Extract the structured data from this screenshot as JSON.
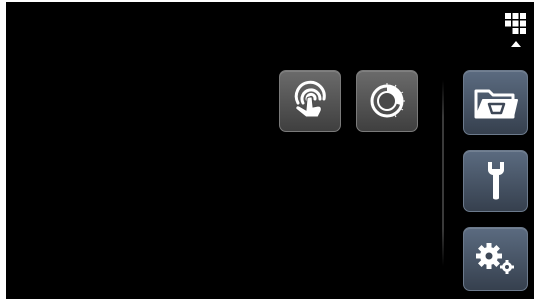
{
  "screen": {
    "background": "#000000"
  },
  "top_right": {
    "grid_icon": "grid-menu-icon",
    "caret_icon": "caret-up-icon"
  },
  "actions": [
    {
      "id": "touch",
      "icon": "touch-hand-icon",
      "style": "gray"
    },
    {
      "id": "timer",
      "icon": "timer-dial-icon",
      "style": "gray"
    }
  ],
  "sidebar": [
    {
      "id": "program",
      "icon": "folder-basket-icon",
      "style": "blue"
    },
    {
      "id": "service",
      "icon": "wrench-icon",
      "style": "blue"
    },
    {
      "id": "settings",
      "icon": "gears-icon",
      "style": "blue"
    }
  ],
  "colors": {
    "tile_gray": "#555555",
    "tile_blue": "#4a5566",
    "icon": "#ffffff"
  }
}
